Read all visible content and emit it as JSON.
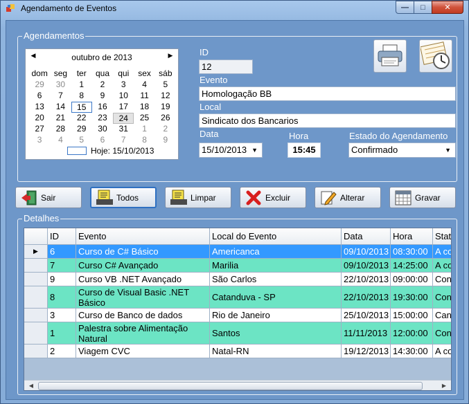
{
  "window": {
    "title": "Agendamento de Eventos",
    "controls": {
      "minimize": "—",
      "maximize": "□",
      "close": "✕"
    }
  },
  "agendamentos": {
    "group_title": "Agendamentos",
    "calendar": {
      "month_label": "outubro de 2013",
      "prev": "◀",
      "next": "▶",
      "weekdays": [
        "dom",
        "seg",
        "ter",
        "qua",
        "qui",
        "sex",
        "sáb"
      ],
      "weeks": [
        [
          "29",
          "30",
          "1",
          "2",
          "3",
          "4",
          "5"
        ],
        [
          "6",
          "7",
          "8",
          "9",
          "10",
          "11",
          "12"
        ],
        [
          "13",
          "14",
          "15",
          "16",
          "17",
          "18",
          "19"
        ],
        [
          "20",
          "21",
          "22",
          "23",
          "24",
          "25",
          "26"
        ],
        [
          "27",
          "28",
          "29",
          "30",
          "31",
          "1",
          "2"
        ],
        [
          "3",
          "4",
          "5",
          "6",
          "7",
          "8",
          "9"
        ]
      ],
      "today_text": "Hoje: 15/10/2013"
    },
    "id_label": "ID",
    "id_value": "12",
    "evento_label": "Evento",
    "evento_value": "Homologação BB",
    "local_label": "Local",
    "local_value": "Sindicato dos Bancarios",
    "data_label": "Data",
    "data_value": "15/10/2013",
    "hora_label": "Hora",
    "hora_value": "15:45",
    "estado_label": "Estado do Agendamento",
    "estado_value": "Confirmado",
    "print_icon": "printer-icon",
    "calendar_icon": "calendar-clock-icon"
  },
  "actions": {
    "sair": "Sair",
    "todos": "Todos",
    "limpar": "Limpar",
    "excluir": "Excluir",
    "alterar": "Alterar",
    "gravar": "Gravar"
  },
  "detalhes": {
    "group_title": "Detalhes",
    "columns": [
      "ID",
      "Evento",
      "Local do Evento",
      "Data",
      "Hora",
      "Status"
    ],
    "rows": [
      [
        "6",
        "Curso de C# Básico",
        "Americanca",
        "09/10/2013",
        "08:30:00",
        "A confirmar"
      ],
      [
        "7",
        "Curso C# Avançado",
        "Marilia",
        "09/10/2013",
        "14:25:00",
        "A confirmar"
      ],
      [
        "9",
        "Curso VB .NET Avançado",
        "São Carlos",
        "22/10/2013",
        "09:00:00",
        "Confirmado"
      ],
      [
        "8",
        "Curso de Visual Basic .NET Básico",
        "Catanduva - SP",
        "22/10/2013",
        "19:30:00",
        "Confirmado"
      ],
      [
        "3",
        "Curso de Banco de dados",
        "Rio de Janeiro",
        "25/10/2013",
        "15:00:00",
        "Cancelado"
      ],
      [
        "1",
        "Palestra sobre Alimentação Natural",
        "Santos",
        "11/11/2013",
        "12:00:00",
        "Confirmado"
      ],
      [
        "2",
        "Viagem CVC",
        "Natal-RN",
        "19/12/2013",
        "14:30:00",
        "A confirmar"
      ]
    ],
    "current_row_marker": "▶",
    "scroll_left": "◀",
    "scroll_right": "▶"
  },
  "colors": {
    "selected_row": "#3399ff",
    "alt_row": "#6ce4c4",
    "group_background": "#6e97c9"
  }
}
